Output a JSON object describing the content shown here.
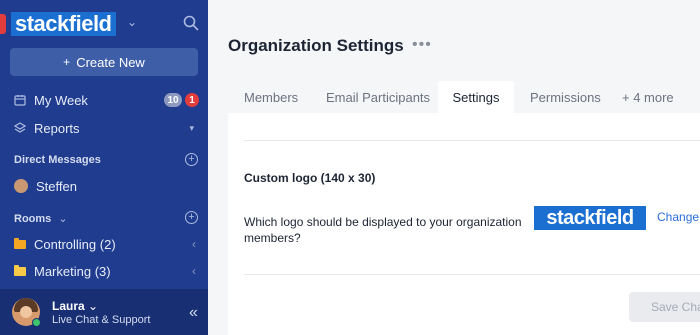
{
  "sidebar": {
    "brand": "stackfield",
    "create_label": "Create New",
    "nav": [
      {
        "label": "My Week",
        "badge_count": "10",
        "badge_alert": "1"
      },
      {
        "label": "Reports"
      }
    ],
    "direct_messages_header": "Direct Messages",
    "contacts": [
      {
        "label": "Steffen"
      }
    ],
    "rooms_header": "Rooms",
    "rooms": [
      {
        "label": "Controlling (2)",
        "color": "#f5a623"
      },
      {
        "label": "Marketing (3)",
        "color": "#f7c948"
      }
    ],
    "user": {
      "name": "Laura",
      "subtitle": "Live Chat & Support"
    }
  },
  "main": {
    "title": "Organization Settings",
    "tabs": [
      {
        "label": "Members"
      },
      {
        "label": "Email Participants"
      },
      {
        "label": "Settings",
        "active": true
      },
      {
        "label": "Permissions"
      },
      {
        "label": "+ 4 more"
      }
    ],
    "custom_logo": {
      "title": "Custom logo (140 x 30)",
      "question": "Which logo should be displayed to your organization members?",
      "preview_text": "stackfield",
      "change_label": "Change"
    },
    "save_label": "Save Changes"
  },
  "colors": {
    "sidebar_bg": "#1f3c8f",
    "brand_blue": "#1a6fd0",
    "alert_red": "#e23c3c",
    "link_blue": "#2a6ed8"
  }
}
